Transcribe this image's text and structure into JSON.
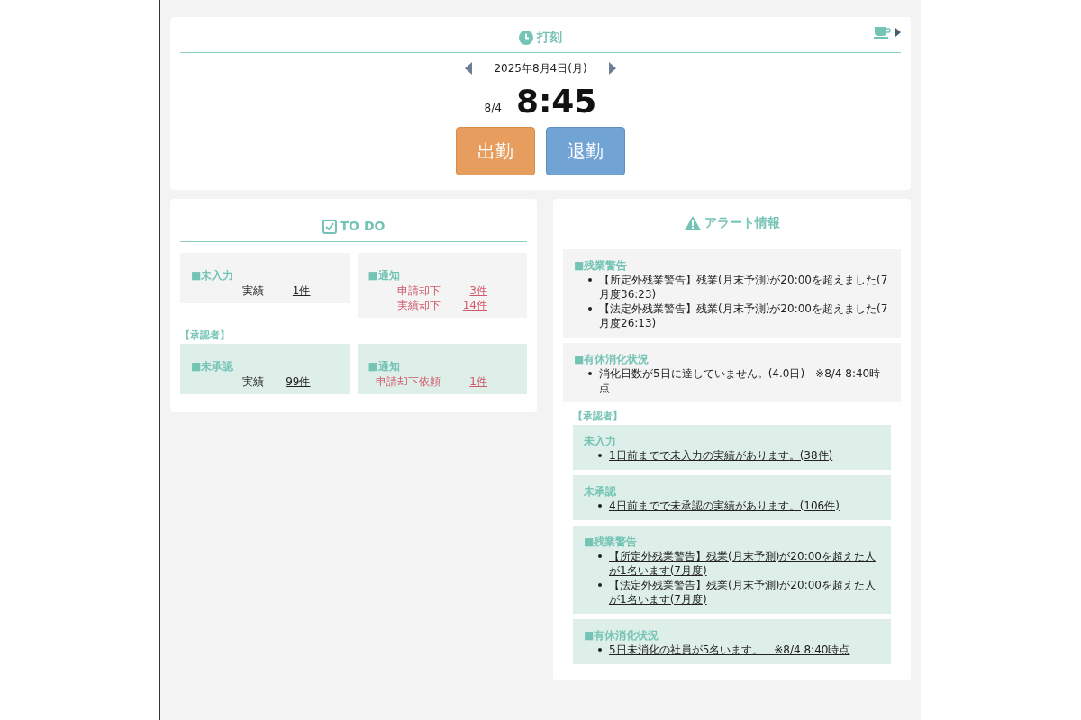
{
  "punch": {
    "title": "打刻",
    "date": "2025年8月4日(月)",
    "time_date": "8/4",
    "time": "8:45",
    "buttons": [
      {
        "label": "出勤",
        "kind": "in"
      },
      {
        "label": "退勤",
        "kind": "out"
      }
    ]
  },
  "todo": {
    "title": "TO DO",
    "groups": [
      {
        "kind": "self",
        "boxes": [
          {
            "title": "■未入力",
            "rows": [
              {
                "label": "実績",
                "count": "1件",
                "kind": "plain"
              }
            ]
          },
          {
            "title": "■通知",
            "rows": [
              {
                "label": "申請却下",
                "count": "3件",
                "kind": "rejected"
              },
              {
                "label": "実績却下",
                "count": "14件",
                "kind": "rejected"
              }
            ]
          }
        ]
      },
      {
        "heading": "【承認者】",
        "kind": "approver",
        "boxes": [
          {
            "title": "■未承認",
            "rows": [
              {
                "label": "実績",
                "count": "99件",
                "kind": "plain"
              }
            ]
          },
          {
            "title": "■通知",
            "rows": [
              {
                "label": "申請却下依頼",
                "count": "1件",
                "kind": "rejected"
              }
            ]
          }
        ]
      }
    ]
  },
  "alerts": {
    "title": "アラート情報",
    "sections": [
      {
        "title": "■残業警告",
        "linked": false,
        "items": [
          "【所定外残業警告】残業(月末予測)が20:00を超えました(7月度36:23)",
          "【法定外残業警告】残業(月末予測)が20:00を超えました(7月度26:13)"
        ]
      },
      {
        "title": "■有休消化状況",
        "linked": false,
        "items": [
          "消化日数が5日に達していません。(4.0日)　※8/4 8:40時点"
        ]
      }
    ],
    "approver": {
      "heading": "【承認者】",
      "sections": [
        {
          "title": "未入力",
          "linked": true,
          "items": [
            "1日前までで未入力の実績があります。(38件)"
          ]
        },
        {
          "title": "未承認",
          "linked": true,
          "items": [
            "4日前までで未承認の実績があります。(106件)"
          ]
        },
        {
          "title": "■残業警告",
          "linked": true,
          "items": [
            "【所定外残業警告】残業(月末予測)が20:00を超えた人が1名います(7月度)",
            "【法定外残業警告】残業(月末予測)が20:00を超えた人が1名います(7月度)"
          ]
        },
        {
          "title": "■有休消化状況",
          "linked": true,
          "items": [
            "5日未消化の社員が5名います。　※8/4 8:40時点"
          ]
        }
      ]
    }
  }
}
